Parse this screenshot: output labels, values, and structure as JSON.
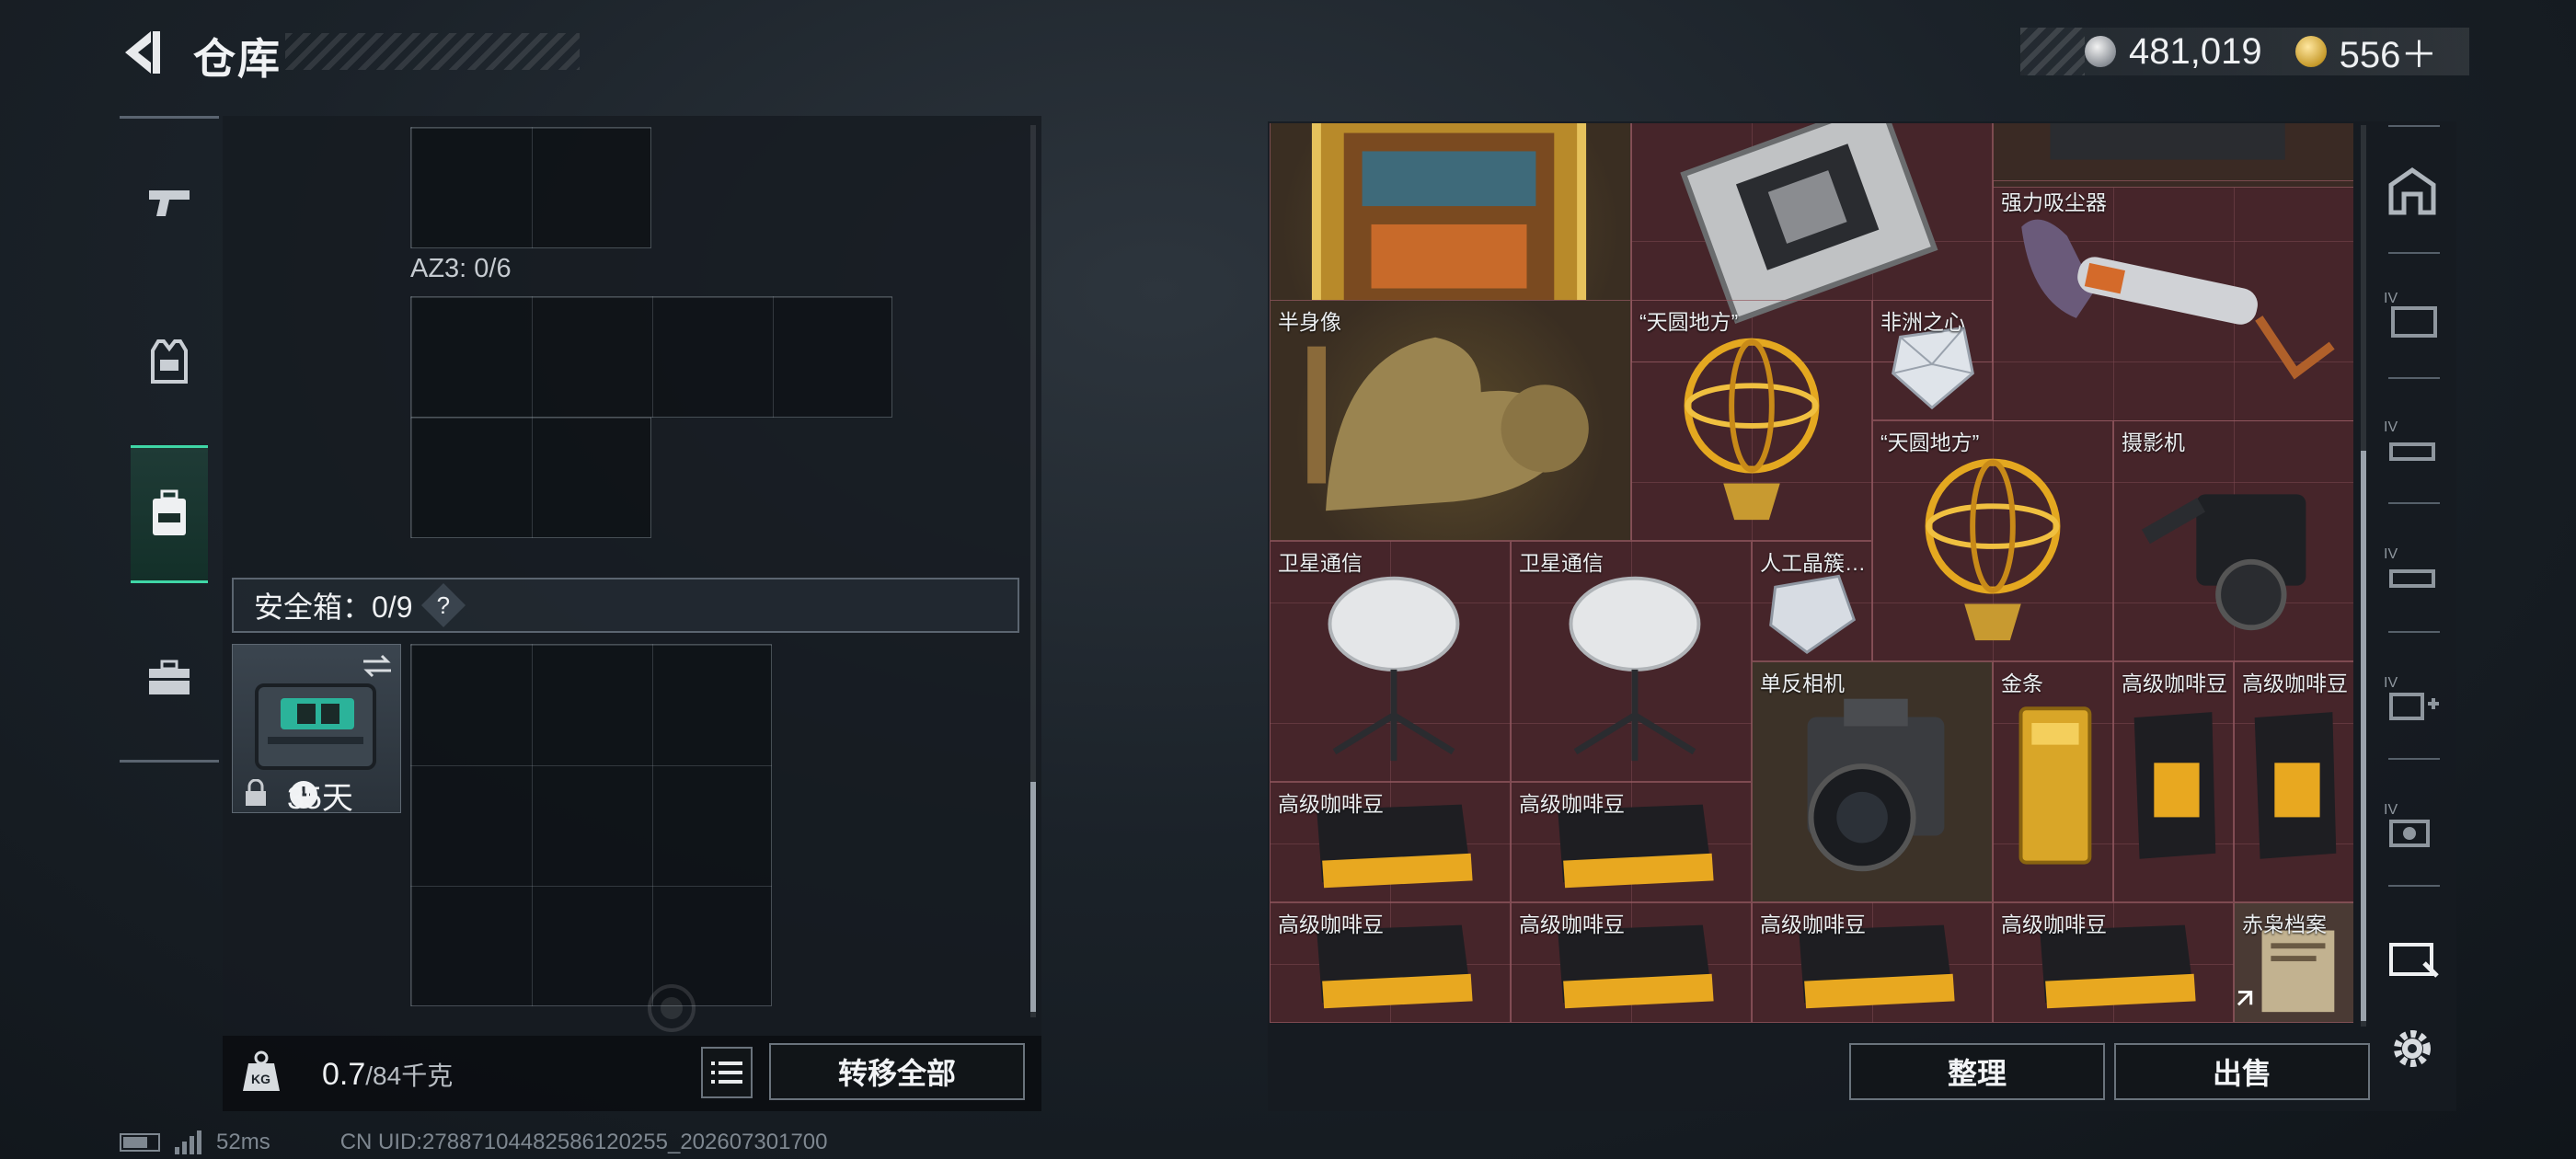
{
  "header": {
    "title": "仓库",
    "currency": [
      {
        "icon": "silver-coin-icon",
        "value": "481,019"
      },
      {
        "icon": "gold-coin-icon",
        "value": "556＋"
      }
    ]
  },
  "categories": [
    {
      "icon": "pistol-icon",
      "active": false
    },
    {
      "icon": "armor-vest-icon",
      "active": false
    },
    {
      "icon": "backpack-icon",
      "active": true
    },
    {
      "icon": "briefcase-icon",
      "active": false
    }
  ],
  "loadout": {
    "az3_label": "AZ3: 0/6",
    "safe_box_label": "安全箱：0/9",
    "safe_box_help": "?",
    "safe_box_days": "35天"
  },
  "weight": {
    "current": "0.7",
    "capacity": "/84千克"
  },
  "buttons": {
    "transfer_all": "转移全部",
    "organize": "整理",
    "sell": "出售"
  },
  "stash_items": [
    {
      "name": "",
      "icon": "framed-painting-icon"
    },
    {
      "name": "",
      "icon": "circuit-board-icon"
    },
    {
      "name": "强力吸尘器",
      "icon": "vacuum-cleaner-icon"
    },
    {
      "name": "半身像",
      "icon": "bronze-bust-icon"
    },
    {
      "name": "“天圆地方”",
      "icon": "armillary-sphere-icon"
    },
    {
      "name": "非洲之心",
      "icon": "diamond-icon"
    },
    {
      "name": "“天圆地方”",
      "icon": "armillary-sphere-icon"
    },
    {
      "name": "摄影机",
      "icon": "film-camera-icon"
    },
    {
      "name": "卫星通信",
      "icon": "satellite-dish-icon"
    },
    {
      "name": "卫星通信",
      "icon": "satellite-dish-icon"
    },
    {
      "name": "人工晶簇…",
      "icon": "crystal-icon"
    },
    {
      "name": "单反相机",
      "icon": "dslr-camera-icon"
    },
    {
      "name": "金条",
      "icon": "gold-bar-icon"
    },
    {
      "name": "高级咖啡豆",
      "icon": "coffee-bag-icon"
    },
    {
      "name": "高级咖啡豆",
      "icon": "coffee-bag-icon"
    },
    {
      "name": "高级咖啡豆",
      "icon": "coffee-pack-icon"
    },
    {
      "name": "高级咖啡豆",
      "icon": "coffee-pack-icon"
    },
    {
      "name": "高级咖啡豆",
      "icon": "coffee-pack-icon"
    },
    {
      "name": "高级咖啡豆",
      "icon": "coffee-pack-icon"
    },
    {
      "name": "高级咖啡豆",
      "icon": "coffee-pack-icon"
    },
    {
      "name": "高级咖啡豆",
      "icon": "coffee-pack-icon"
    },
    {
      "name": "赤枭档案",
      "icon": "dossier-icon"
    }
  ],
  "filters": [
    {
      "icon": "stash-home-icon"
    },
    {
      "icon": "stash-tab-1-icon"
    },
    {
      "icon": "stash-tab-2-icon"
    },
    {
      "icon": "stash-tab-3-icon"
    },
    {
      "icon": "stash-tab-4-icon"
    },
    {
      "icon": "stash-tab-5-icon"
    },
    {
      "icon": "stash-tab-6-icon"
    },
    {
      "icon": "settings-gear-icon"
    }
  ],
  "status": {
    "ping": "52ms",
    "uid": "CN UID:2788710448258612025​5_202607301700"
  },
  "colors": {
    "accent": "#3fd6a6",
    "stash_bg": "#46252a",
    "panel_bg": "#161b21"
  }
}
